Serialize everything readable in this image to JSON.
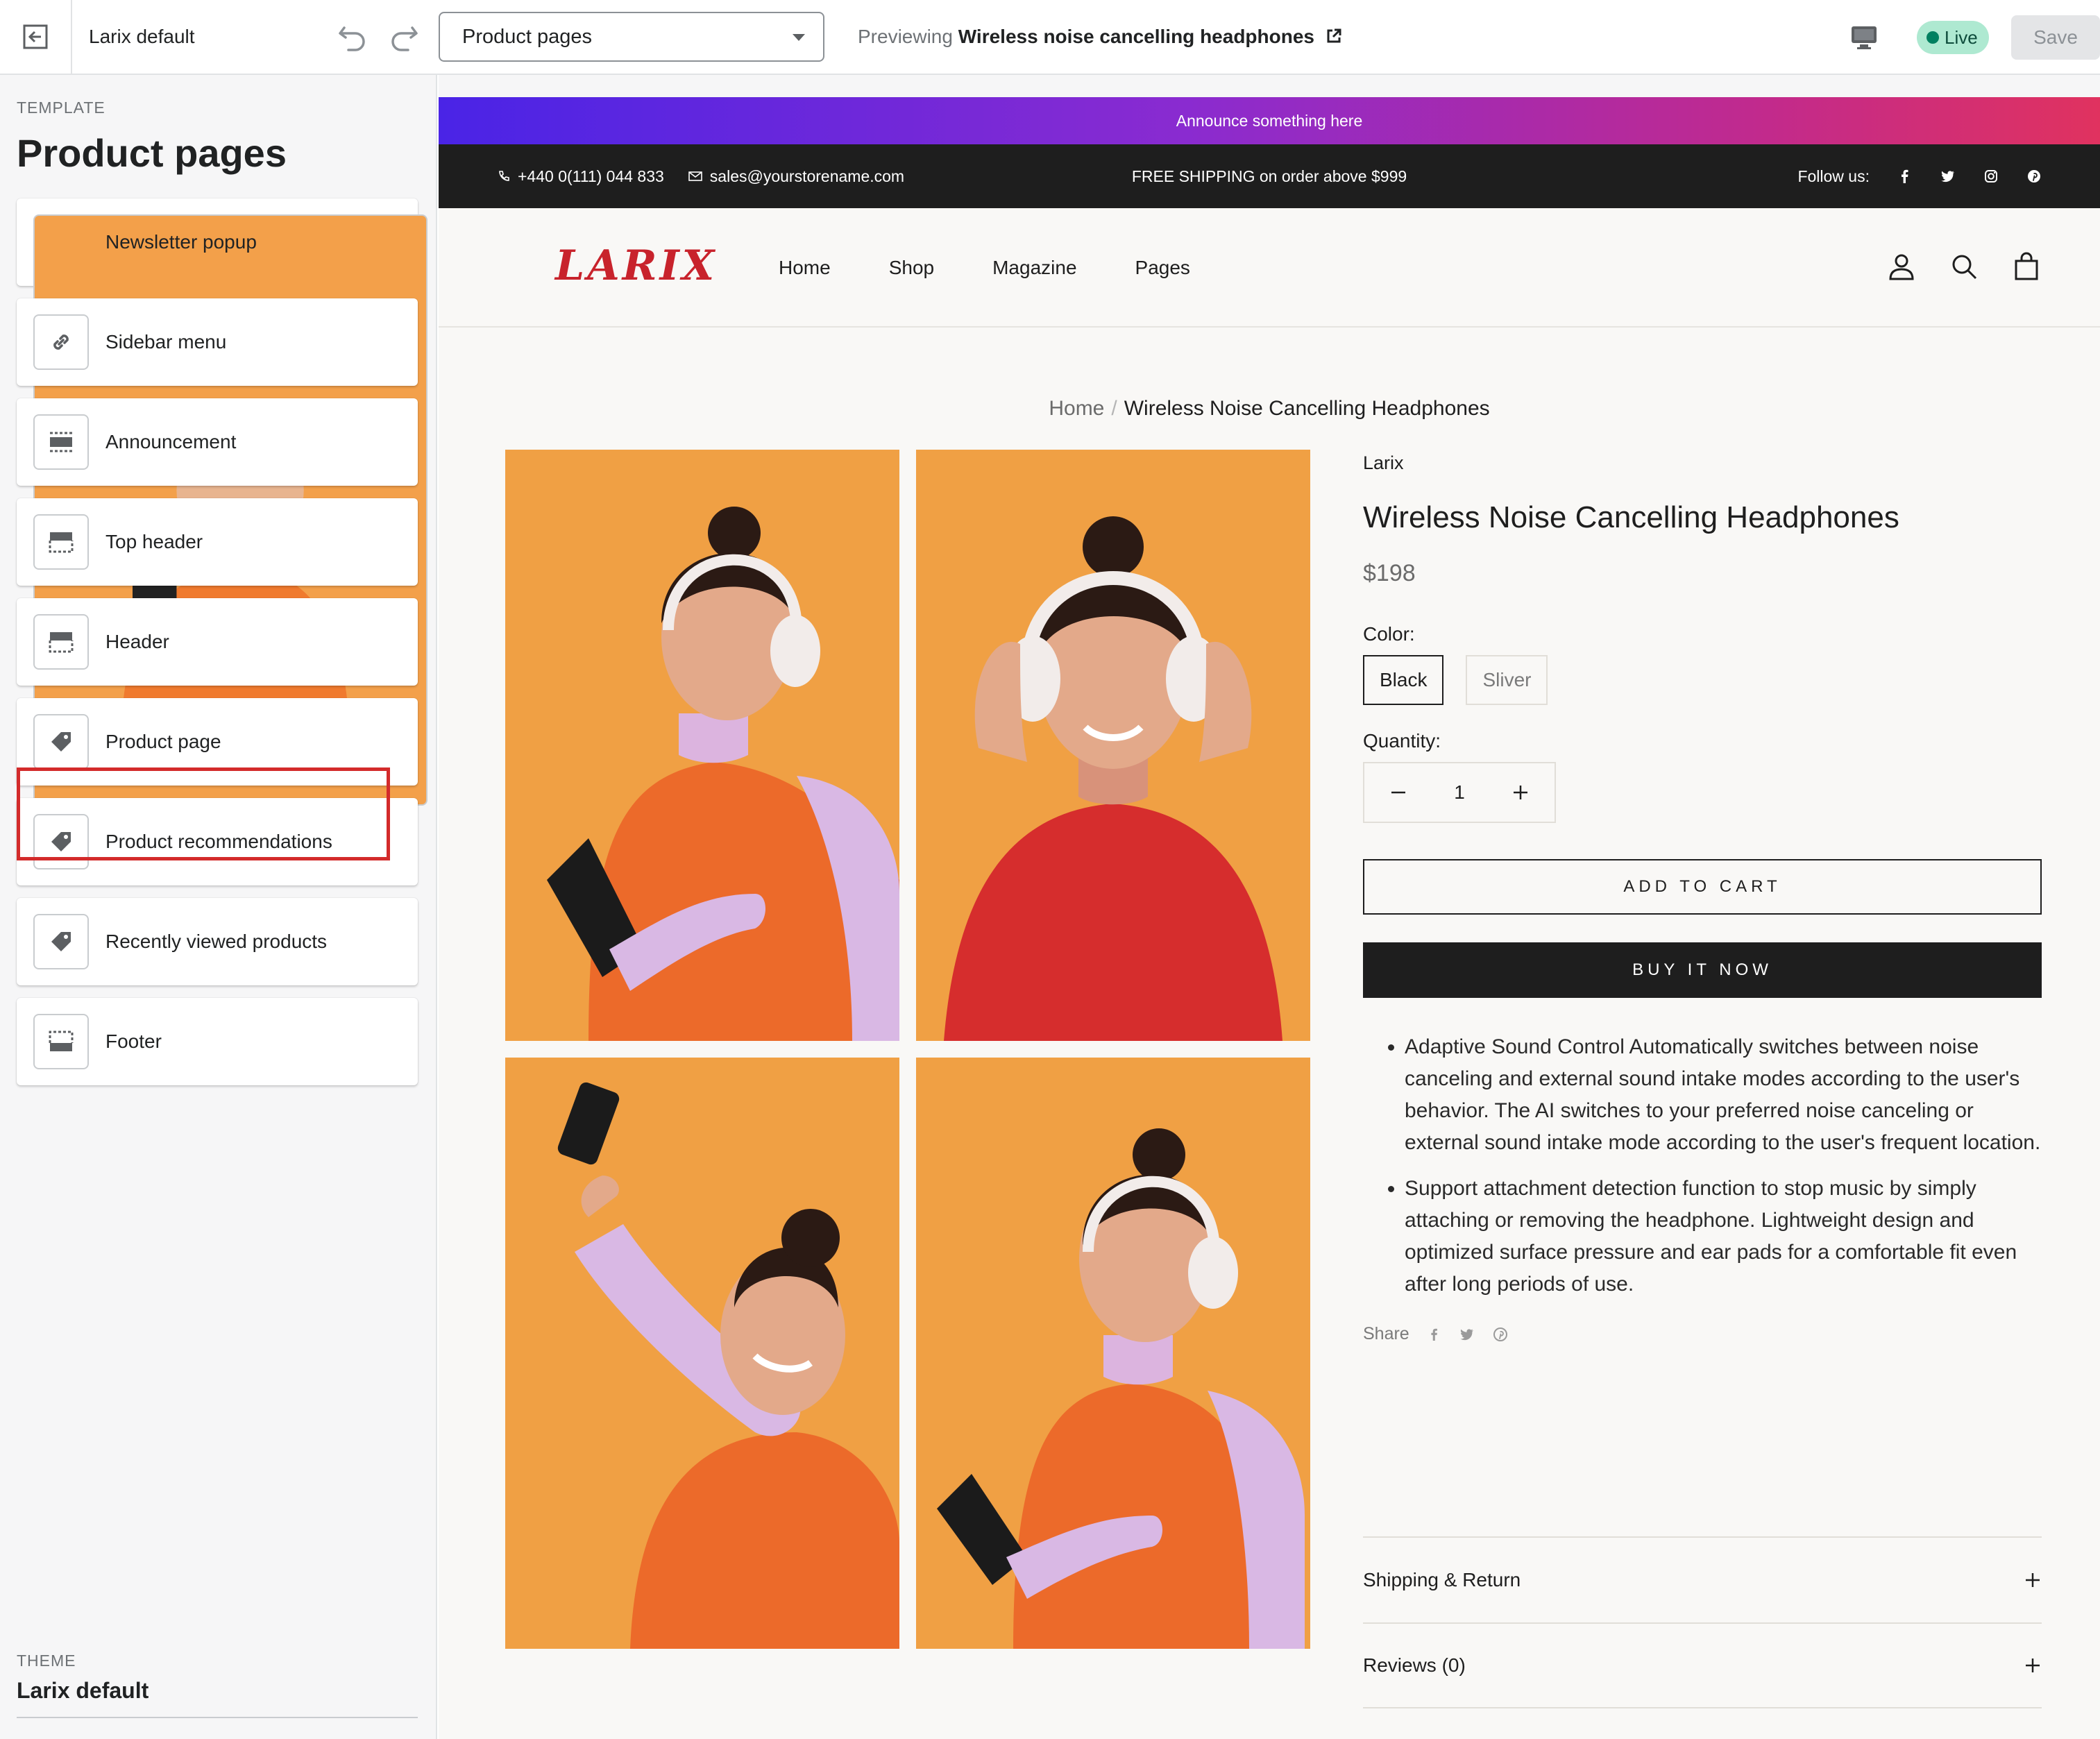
{
  "editor": {
    "theme_name": "Larix default",
    "template_select": "Product pages",
    "preview_prefix": "Previewing",
    "preview_product": "Wireless noise cancelling headphones",
    "live_label": "Live",
    "save_label": "Save"
  },
  "sidebar": {
    "overline": "TEMPLATE",
    "title": "Product pages",
    "items": [
      {
        "label": "Newsletter popup",
        "icon": "photo-thumbnail"
      },
      {
        "label": "Sidebar menu",
        "icon": "link-icon"
      },
      {
        "label": "Announcement",
        "icon": "section-icon"
      },
      {
        "label": "Top header",
        "icon": "header-section-icon"
      },
      {
        "label": "Header",
        "icon": "header-section-icon"
      },
      {
        "label": "Product page",
        "icon": "tag-icon",
        "highlighted": true
      },
      {
        "label": "Product recommendations",
        "icon": "tag-icon"
      },
      {
        "label": "Recently viewed products",
        "icon": "tag-icon"
      },
      {
        "label": "Footer",
        "icon": "footer-section-icon"
      }
    ],
    "footer_overline": "THEME",
    "footer_theme": "Larix default"
  },
  "store": {
    "announcement": "Announce something here",
    "phone": "+440 0(111) 044 833",
    "email": "sales@yourstorename.com",
    "shipping": "FREE SHIPPING on order above $999",
    "follow": "Follow us:",
    "logo": "LARIX",
    "nav": [
      "Home",
      "Shop",
      "Magazine",
      "Pages"
    ],
    "breadcrumb_home": "Home",
    "breadcrumb_current": "Wireless Noise Cancelling Headphones"
  },
  "product": {
    "brand": "Larix",
    "title": "Wireless Noise Cancelling Headphones",
    "price": "$198",
    "color_label": "Color:",
    "colors": [
      "Black",
      "Sliver"
    ],
    "selected_color": "Black",
    "quantity_label": "Quantity:",
    "quantity": "1",
    "add_to_cart": "ADD TO CART",
    "buy_now": "BUY IT NOW",
    "description": [
      "Adaptive Sound Control Automatically switches between noise canceling and external sound intake modes according to the user's behavior. The AI switches to your preferred noise canceling or external sound intake mode according to the user's frequent location.",
      "Support attachment detection function to stop music by simply attaching or removing the headphone. Lightweight design and optimized surface pressure and ear pads for a comfortable fit even after long periods of use."
    ],
    "share_label": "Share",
    "accordions": [
      "Shipping & Return",
      "Reviews (0)"
    ]
  },
  "colors": {
    "highlight": "#d32b2b",
    "live_badge": "#aee9d1",
    "photo_background": "#f0a044",
    "logo": "#c8232c",
    "dark": "#1e1e1e"
  }
}
